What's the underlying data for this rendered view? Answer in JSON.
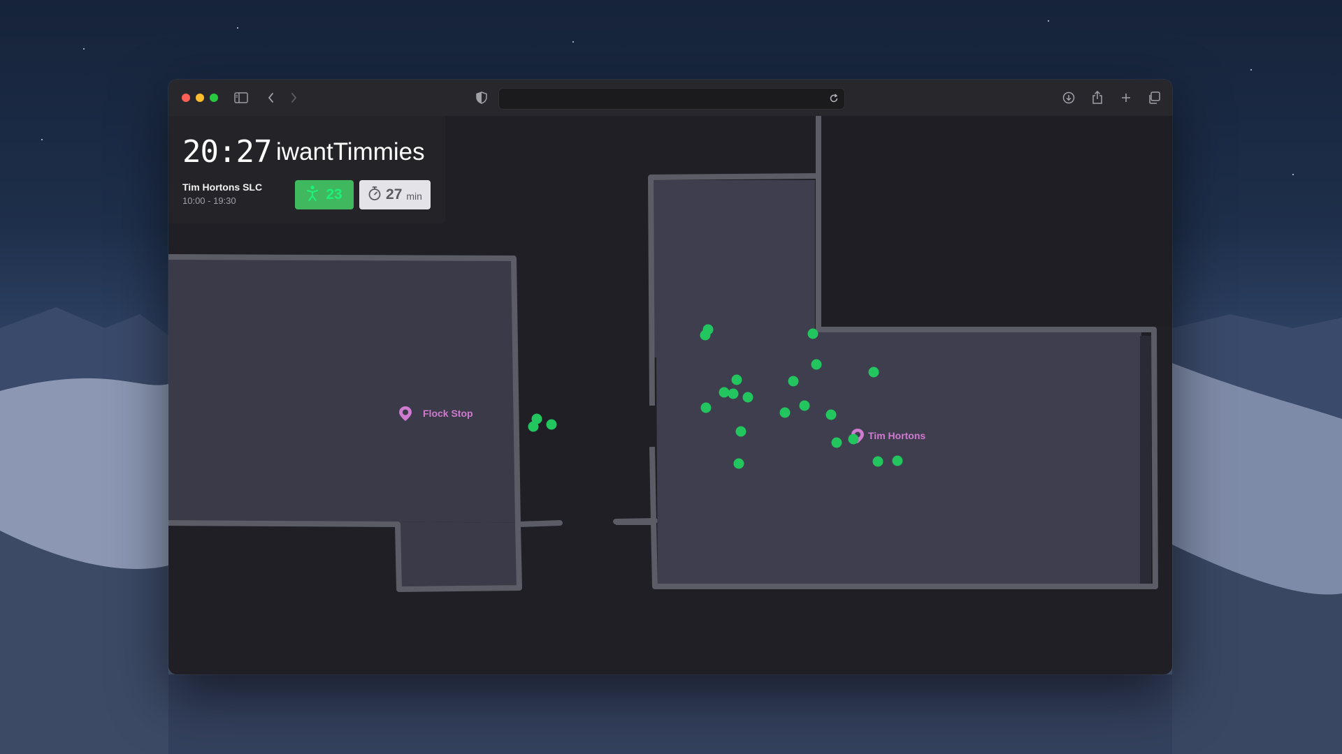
{
  "window": {
    "toolbar": {
      "sidebar_icon": "sidebar-icon",
      "back_icon": "chevron-left-icon",
      "forward_icon": "chevron-right-icon",
      "privacy_icon": "shield-icon",
      "address_value": "",
      "reload_icon": "reload-icon",
      "download_icon": "download-icon",
      "share_icon": "share-icon",
      "new_tab_icon": "plus-icon",
      "tabs_overview_icon": "tabs-icon"
    }
  },
  "info_panel": {
    "clock": "20:27",
    "username": "iwantTimmies",
    "venue_name": "Tim Hortons SLC",
    "venue_hours": "10:00 - 19:30",
    "people_count": "23",
    "wait_time": "27",
    "wait_unit": "min"
  },
  "map": {
    "pins": [
      {
        "label": "Flock Stop"
      },
      {
        "label": "Tim Hortons"
      }
    ],
    "person_count_shown": 23
  },
  "colors": {
    "accent_green": "#3fb860",
    "pin_magenta": "#d07ad0",
    "dot_green": "#22c55e"
  }
}
